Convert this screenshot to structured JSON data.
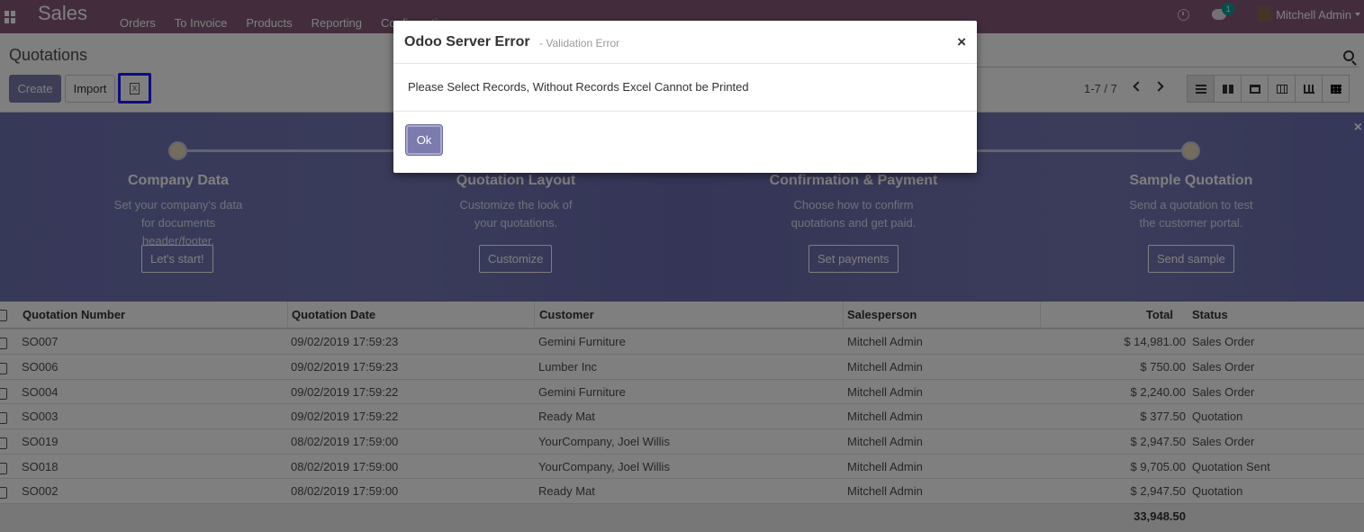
{
  "navbar": {
    "app_name": "Sales",
    "menu": [
      "Orders",
      "To Invoice",
      "Products",
      "Reporting",
      "Configuration"
    ],
    "chat_badge": "1",
    "user_name": "Mitchell Admin"
  },
  "control_panel": {
    "breadcrumb": "Quotations",
    "create_label": "Create",
    "import_label": "Import",
    "excel_glyph": "X",
    "pager": "1-7 / 7",
    "views": [
      "list-view-icon",
      "kanban-view-icon",
      "calendar-view-icon",
      "pivot-view-icon",
      "graph-view-icon",
      "activity-view-icon"
    ]
  },
  "banner": {
    "close": "×",
    "steps": [
      {
        "title": "Company Data",
        "desc": "Set your company's data for documents header/footer.",
        "button": "Let's start!"
      },
      {
        "title": "Quotation Layout",
        "desc": "Customize the look of your quotations.",
        "button": "Customize"
      },
      {
        "title": "Confirmation & Payment",
        "desc": "Choose how to confirm quotations and get paid.",
        "button": "Set payments"
      },
      {
        "title": "Sample Quotation",
        "desc": "Send a quotation to test the customer portal.",
        "button": "Send sample"
      }
    ]
  },
  "table": {
    "headers": [
      "Quotation Number",
      "Quotation Date",
      "Customer",
      "Salesperson",
      "Total",
      "Status"
    ],
    "rows": [
      [
        "SO007",
        "09/02/2019 17:59:23",
        "Gemini Furniture",
        "Mitchell Admin",
        "$ 14,981.00",
        "Sales Order"
      ],
      [
        "SO006",
        "09/02/2019 17:59:23",
        "Lumber Inc",
        "Mitchell Admin",
        "$ 750.00",
        "Sales Order"
      ],
      [
        "SO004",
        "09/02/2019 17:59:22",
        "Gemini Furniture",
        "Mitchell Admin",
        "$ 2,240.00",
        "Sales Order"
      ],
      [
        "SO003",
        "09/02/2019 17:59:22",
        "Ready Mat",
        "Mitchell Admin",
        "$ 377.50",
        "Quotation"
      ],
      [
        "SO019",
        "08/02/2019 17:59:00",
        "YourCompany, Joel Willis",
        "Mitchell Admin",
        "$ 2,947.50",
        "Sales Order"
      ],
      [
        "SO018",
        "08/02/2019 17:59:00",
        "YourCompany, Joel Willis",
        "Mitchell Admin",
        "$ 9,705.00",
        "Quotation Sent"
      ],
      [
        "SO002",
        "08/02/2019 17:59:00",
        "Ready Mat",
        "Mitchell Admin",
        "$ 2,947.50",
        "Quotation"
      ]
    ],
    "total": "33,948.50"
  },
  "dialog": {
    "title": "Odoo Server Error",
    "subtitle": "- Validation Error",
    "close": "×",
    "message": "Please Select Records, Without Records Excel Cannot be Printed",
    "ok_label": "Ok"
  }
}
